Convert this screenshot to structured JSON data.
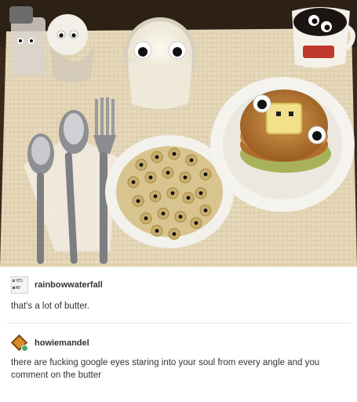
{
  "photo": {
    "icons": [
      "salt-shaker",
      "egg-with-eyes",
      "milk-glass",
      "syrup-jug",
      "spoon",
      "spoon",
      "fork",
      "cereal-bowl",
      "pancake-plate"
    ]
  },
  "posts": [
    {
      "username": "rainbowwaterfall",
      "avatar_icon": "yes-no-checkbox-avatar",
      "avatar_lines": [
        "YES",
        "NO"
      ],
      "text": "that's a lot of butter."
    },
    {
      "username": "howiemandel",
      "avatar_icon": "orange-diamond-avatar",
      "text": "there are fucking google eyes staring into your soul from every angle and you comment on the butter"
    }
  ],
  "colors": {
    "text": "#333333",
    "divider": "#e6e6e6",
    "placemat": "#e9dcc0",
    "pancake": "#c58a3a",
    "butter": "#f3e08a"
  }
}
